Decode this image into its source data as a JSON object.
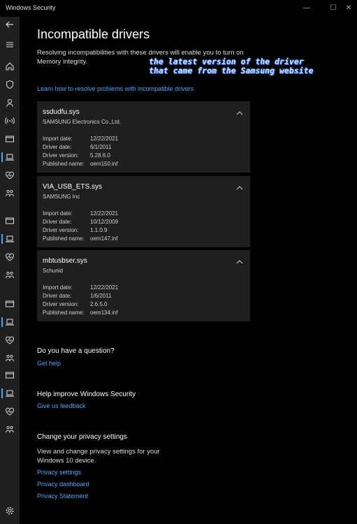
{
  "window": {
    "title": "Windows Security",
    "controls": [
      "—",
      "☐",
      "✕"
    ]
  },
  "page": {
    "title": "Incompatible drivers",
    "intro": "Resolving incompatibilities with these drivers will enable you to turn on Memory integrity.",
    "annotation_line1": "the latest version of the driver",
    "annotation_line2": "that came from the Samsung website",
    "learn_link": "Learn how to resolve problems with incompatible drivers"
  },
  "labels": {
    "import_date": "Import date:",
    "driver_date": "Driver date:",
    "driver_version": "Driver version:",
    "published_name": "Published name:"
  },
  "drivers": [
    {
      "name": "ssdudfu.sys",
      "vendor": "SAMSUNG Electronics Co.,Ltd.",
      "import_date": "12/22/2021",
      "driver_date": "6/1/2011",
      "driver_version": "5.28.6.0",
      "published_name": "oem150.inf"
    },
    {
      "name": "VIA_USB_ETS.sys",
      "vendor": "SAMSUNG Inc",
      "import_date": "12/22/2021",
      "driver_date": "10/12/2009",
      "driver_version": "1.1.0.9",
      "published_name": "oem147.inf"
    },
    {
      "name": "mbtusbser.sys",
      "vendor": "Schunid",
      "import_date": "12/22/2021",
      "driver_date": "1/6/2011",
      "driver_version": "2.6.5.0",
      "published_name": "oem134.inf"
    }
  ],
  "question": {
    "heading": "Do you have a question?",
    "link": "Get help"
  },
  "improve": {
    "heading": "Help improve Windows Security",
    "link": "Give us feedback"
  },
  "privacy": {
    "heading": "Change your privacy settings",
    "text": "View and change privacy settings for your Windows 10 device.",
    "links": [
      "Privacy settings",
      "Privacy dashboard",
      "Privacy Statement"
    ]
  },
  "colors": {
    "accent": "#4ea5f5",
    "sidebar": "#1f1f1f",
    "card": "#1f1f1f",
    "background": "#000000"
  },
  "sidebar_icons": [
    "back-arrow-icon",
    "hamburger-icon",
    "home-icon",
    "shield-icon",
    "person-icon",
    "wireless-icon",
    "app-browser-icon",
    "laptop-icon",
    "heart-icon",
    "family-icon",
    "app-browser-icon",
    "laptop-icon",
    "heart-icon",
    "family-icon",
    "app-browser-icon",
    "laptop-icon",
    "heart-icon",
    "family-icon",
    "app-browser-icon",
    "laptop-icon",
    "heart-icon",
    "family-icon",
    "gear-icon"
  ]
}
